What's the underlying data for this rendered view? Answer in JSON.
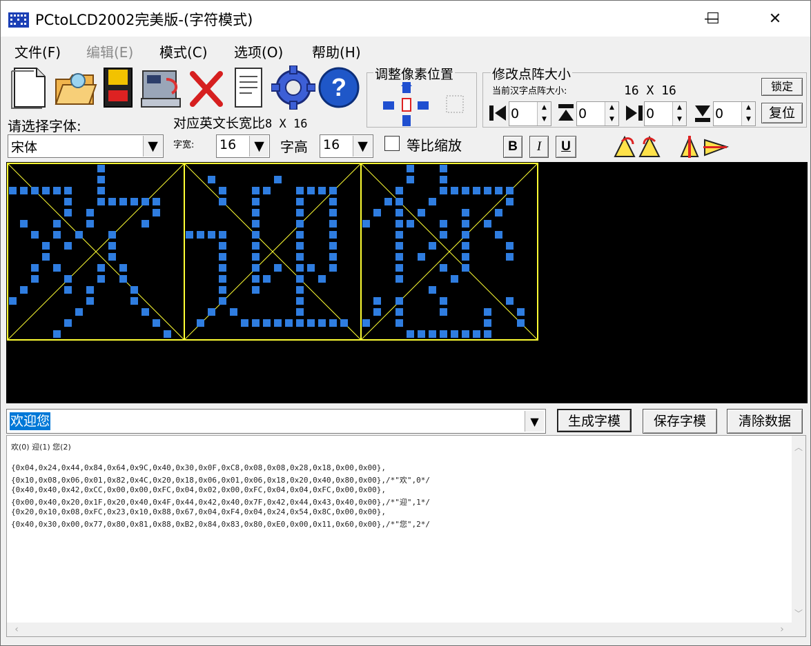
{
  "window": {
    "title": "PCtoLCD2002完美版-(字符模式)",
    "minimize": "—",
    "maximize": "☐",
    "close": "✕"
  },
  "menu": [
    {
      "label": "文件(F)",
      "disabled": false
    },
    {
      "label": "编辑(E)",
      "disabled": true
    },
    {
      "label": "模式(C)",
      "disabled": false
    },
    {
      "label": "选项(O)",
      "disabled": false
    },
    {
      "label": "帮助(H)",
      "disabled": false
    }
  ],
  "toolbar": [
    "new-file-icon",
    "open-folder-icon",
    "save-icon",
    "save-as-icon",
    "delete-icon",
    "notepad-icon",
    "settings-gear-icon",
    "help-icon"
  ],
  "pixel_adjust": {
    "title": "调整像素位置"
  },
  "matrix_size": {
    "title": "修改点阵大小",
    "current_label": "当前汉字点阵大小:",
    "current_value": "16 X 16",
    "lock_label": "锁定",
    "reset_label": "复位",
    "spinners": [
      "0",
      "0",
      "0",
      "0"
    ]
  },
  "font": {
    "select_label": "请选择字体:",
    "select_value": "宋体",
    "eng_size_label": "对应英文长宽比",
    "eng_size_value": "8 X 16",
    "width_label": "字宽:",
    "width_value": "16",
    "height_label": "字高",
    "height_value": "16",
    "proportional_label": "等比缩放"
  },
  "style_buttons": {
    "bold": "B",
    "italic": "I",
    "underline": "U"
  },
  "glyph_preview": {
    "chars": [
      "欢",
      "迎",
      "您"
    ],
    "pixel_color": "#2f7de0",
    "border_color": "#ffff33",
    "background": "#000000"
  },
  "input": {
    "value": "欢迎您"
  },
  "actions": {
    "generate": "生成字模",
    "save": "保存字模",
    "clear": "清除数据"
  },
  "output": {
    "header": "欢(0) 迎(1) 您(2)",
    "lines": [
      "{0x04,0x24,0x44,0x84,0x64,0x9C,0x40,0x30,0x0F,0xC8,0x08,0x08,0x28,0x18,0x00,0x00},",
      "{0x10,0x08,0x06,0x01,0x82,0x4C,0x20,0x18,0x06,0x01,0x06,0x18,0x20,0x40,0x80,0x00},/*\"欢\",0*/",
      "{0x40,0x40,0x42,0xCC,0x00,0x00,0xFC,0x04,0x02,0x00,0xFC,0x04,0x04,0xFC,0x00,0x00},",
      "{0x00,0x40,0x20,0x1F,0x20,0x40,0x4F,0x44,0x42,0x40,0x7F,0x42,0x44,0x43,0x40,0x00},/*\"迎\",1*/",
      "{0x20,0x10,0x08,0xFC,0x23,0x10,0x88,0x67,0x04,0xF4,0x04,0x24,0x54,0x8C,0x00,0x00},",
      "{0x40,0x30,0x00,0x77,0x80,0x81,0x88,0xB2,0x84,0x83,0x80,0xE0,0x00,0x11,0x60,0x00},/*\"您\",2*/"
    ]
  }
}
